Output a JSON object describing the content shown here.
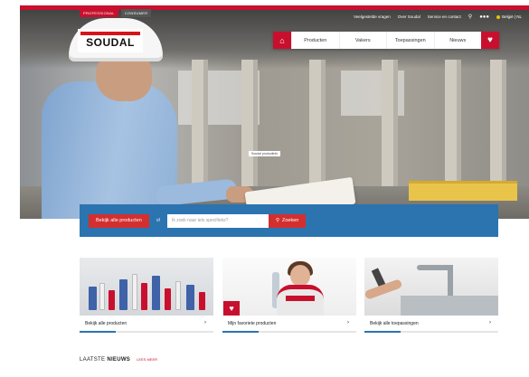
{
  "header": {
    "segment_tabs": [
      "PROFESSIONAL",
      "CONSUMER"
    ],
    "utility_links": [
      "Veelgestelde vragen",
      "Over Soudal",
      "Service en contact"
    ],
    "country_selector": "België | NL",
    "logo_text": "SOUDAL",
    "brand_color": "#c8102e"
  },
  "nav": {
    "home_icon": "home-icon",
    "items": [
      "Producten",
      "Vakers",
      "Toepassingen",
      "Nieuws"
    ],
    "favorite_icon": "heart-icon"
  },
  "hero": {
    "caption": "Soudal productinfo"
  },
  "search": {
    "all_products_label": "Bekijk alle producten",
    "or_text": "of",
    "placeholder": "Ik zoek naar iets specifieks?",
    "submit_label": "Zoeken",
    "bar_color": "#2b74b0"
  },
  "cards": [
    {
      "label": "Bekijk alle producten"
    },
    {
      "label": "Mijn favoriete producten"
    },
    {
      "label": "Bekijk alle toepassingen"
    }
  ],
  "news": {
    "title_light": "LAATSTE",
    "title_bold": "NIEUWS",
    "more_link": "LEES MEER"
  }
}
